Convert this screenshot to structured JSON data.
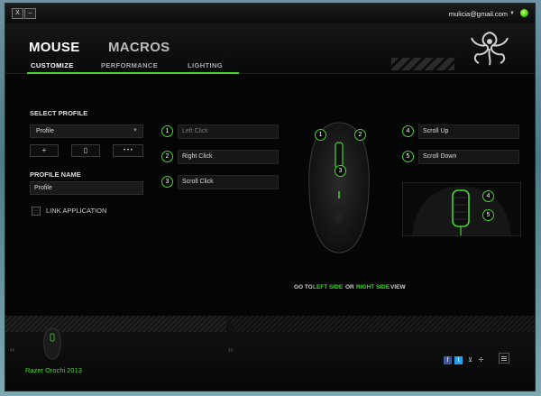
{
  "window": {
    "close_label": "X",
    "minimize_label": "–",
    "account_email": "mulicia@gmail.com",
    "account_caret": "▼"
  },
  "main_tabs": {
    "mouse": "MOUSE",
    "macros": "MACROS"
  },
  "sub_tabs": {
    "customize": "CUSTOMIZE",
    "performance": "PERFORMANCE",
    "lighting": "LIGHTING"
  },
  "profile": {
    "select_heading": "SELECT PROFILE",
    "selected": "Profile",
    "add_label": "+",
    "delete_label": "▯",
    "more_label": "• • •",
    "name_heading": "PROFILE NAME",
    "name_value": "Profile",
    "link_application_label": "LINK APPLICATION"
  },
  "buttons_left": [
    {
      "num": "1",
      "label": "Left Click"
    },
    {
      "num": "2",
      "label": "Right Click"
    },
    {
      "num": "3",
      "label": "Scroll Click"
    }
  ],
  "buttons_right": [
    {
      "num": "4",
      "label": "Scroll Up"
    },
    {
      "num": "5",
      "label": "Scroll Down"
    }
  ],
  "mouse_markers": {
    "m1": "1",
    "m2": "2",
    "m3": "3",
    "m4": "4",
    "m5": "5"
  },
  "side_view": {
    "goto": "GO TO",
    "left_side": "LEFT SIDE",
    "or": "OR",
    "right_side": "RIGHT SIDE",
    "view": "VIEW"
  },
  "footer": {
    "device_name": "Razer Orochi 2013",
    "prev_arrow": "‹‹",
    "next_arrow": "››"
  },
  "colors": {
    "accent": "#44d62c",
    "background": "#050505",
    "field": "#161616"
  },
  "icons": [
    "razer-logo-icon",
    "facebook-icon",
    "twitter-icon",
    "cart-icon",
    "razer-small-icon",
    "menu-icon",
    "status-dot-icon"
  ]
}
